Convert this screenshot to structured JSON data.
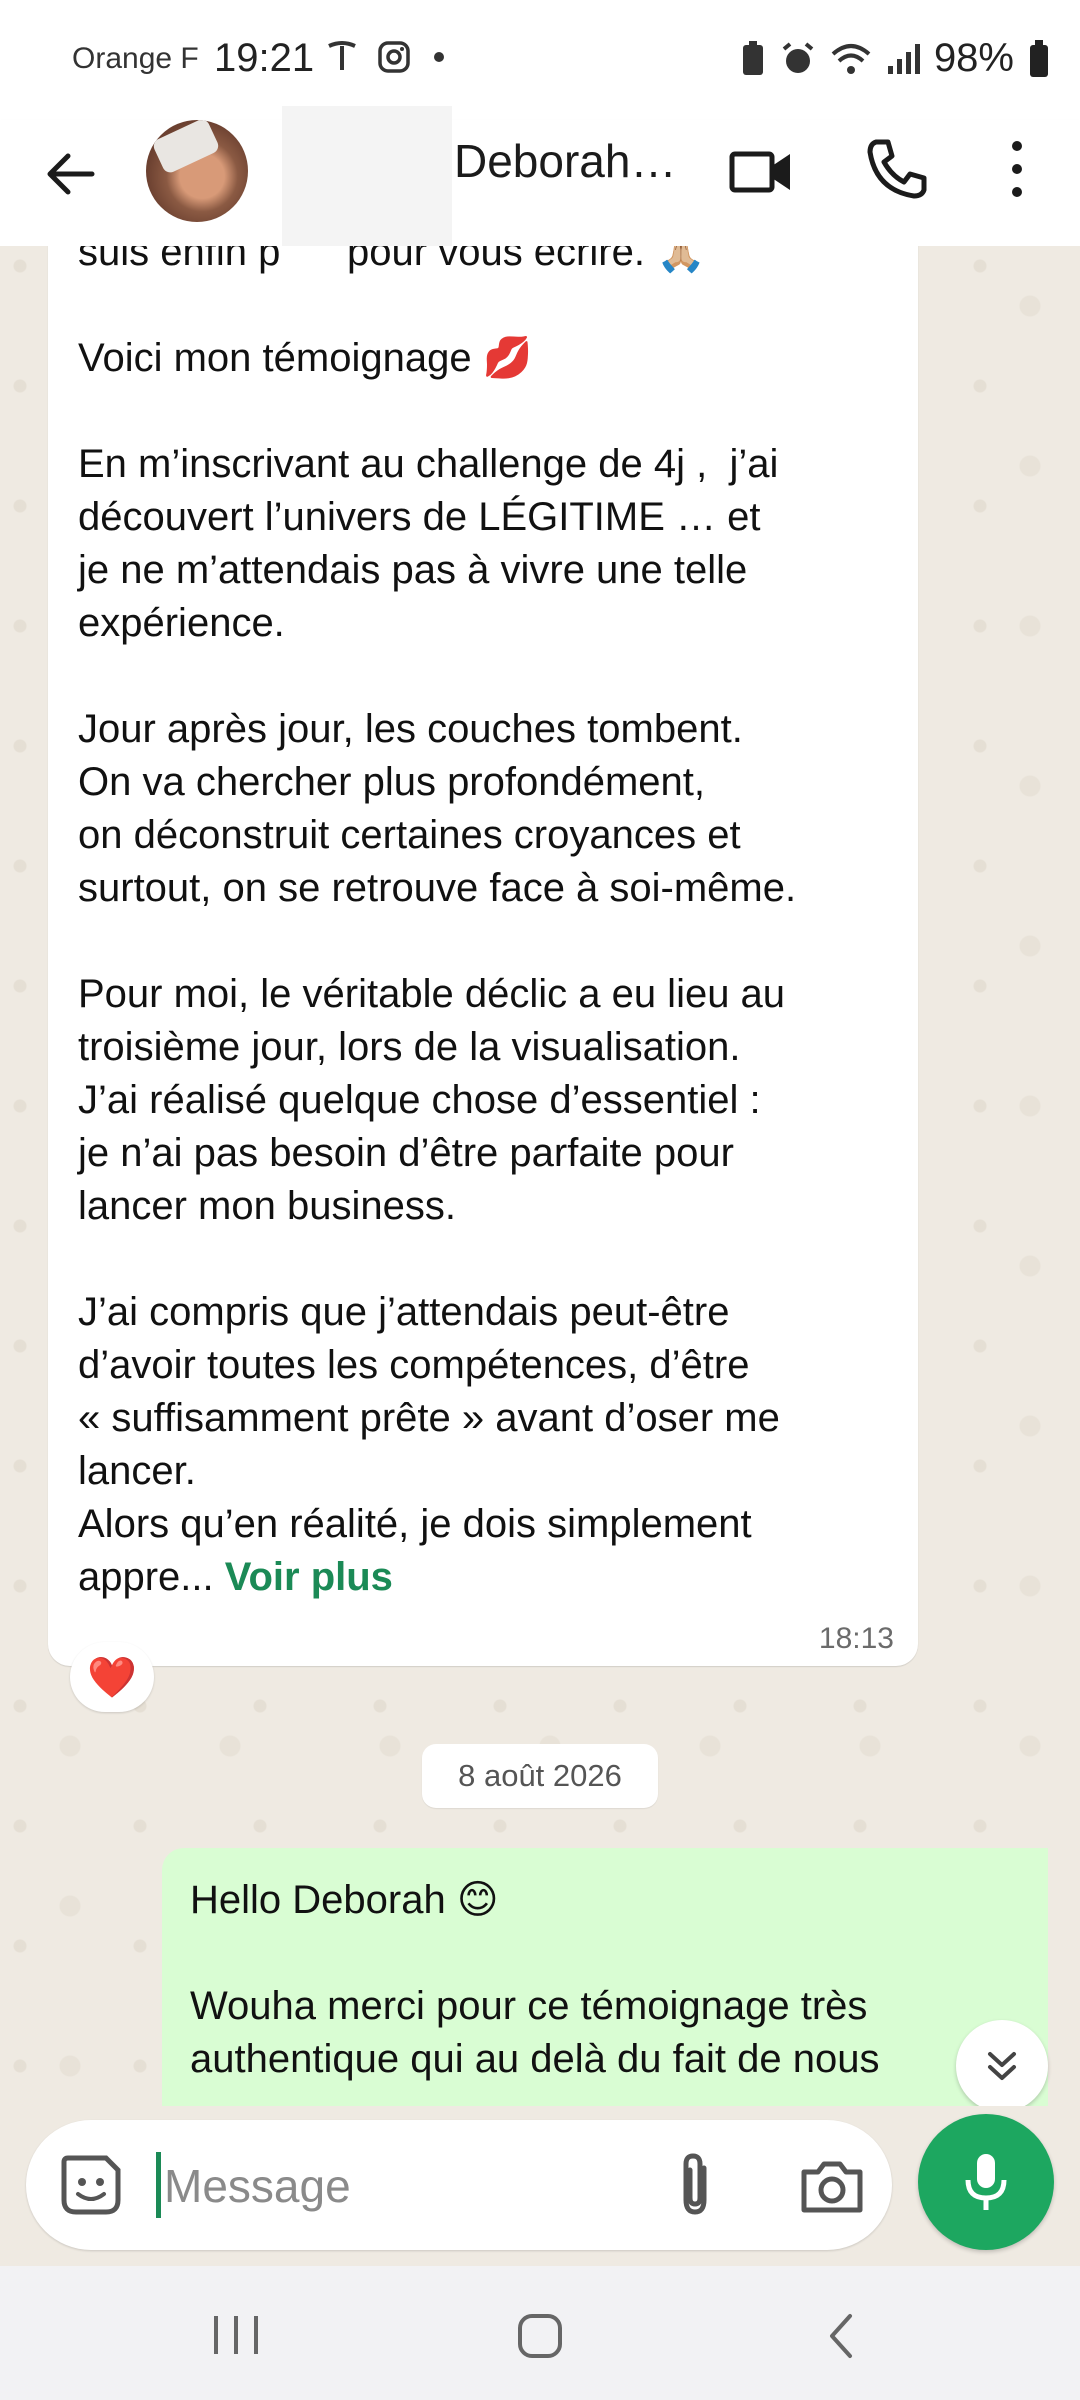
{
  "status_bar": {
    "carrier": "Orange F",
    "time": "19:21",
    "battery": "98%",
    "left_icons": [
      "tesla-icon",
      "instagram-icon",
      "dot-icon"
    ],
    "right_icons": [
      "battery-saver-icon",
      "alarm-icon",
      "wifi-icon",
      "signal-icon",
      "battery-icon"
    ]
  },
  "header": {
    "contact_name": "Deborah…"
  },
  "messages": {
    "incoming_text": "suis enfin p      pour vous écrire. 🙏🏼\n\nVoici mon témoignage 💋\n\nEn m’inscrivant au challenge de 4j ,  j’ai\ndécouvert l’univers de LÉGITIME … et\nje ne m’attendais pas à vivre une telle\nexpérience.\n\nJour après jour, les couches tombent.\nOn va chercher plus profondément,\non déconstruit certaines croyances et\nsurtout, on se retrouve face à soi-même.\n\nPour moi, le véritable déclic a eu lieu au\ntroisième jour, lors de la visualisation.\nJ’ai réalisé quelque chose d’essentiel :\nje n’ai pas besoin d’être parfaite pour\nlancer mon business.\n\nJ’ai compris que j’attendais peut-être\nd’avoir toutes les compétences, d’être\n« suffisamment prête » avant d’oser me\nlancer.\nAlors qu’en réalité, je dois simplement\nappre... ",
    "read_more": "Voir plus",
    "incoming_time": "18:13",
    "reaction": "❤️",
    "date_divider": "8 août 2026",
    "outgoing_text": "Hello Deborah 😊\n\nWouha merci pour ce témoignage très\nauthentique qui au delà du fait de nous"
  },
  "composer": {
    "placeholder": "Message"
  },
  "colors": {
    "accent_green": "#1da760",
    "outgoing_bubble": "#d9fdd3",
    "chat_background": "#efeae2",
    "link_green": "#1b8a56"
  }
}
